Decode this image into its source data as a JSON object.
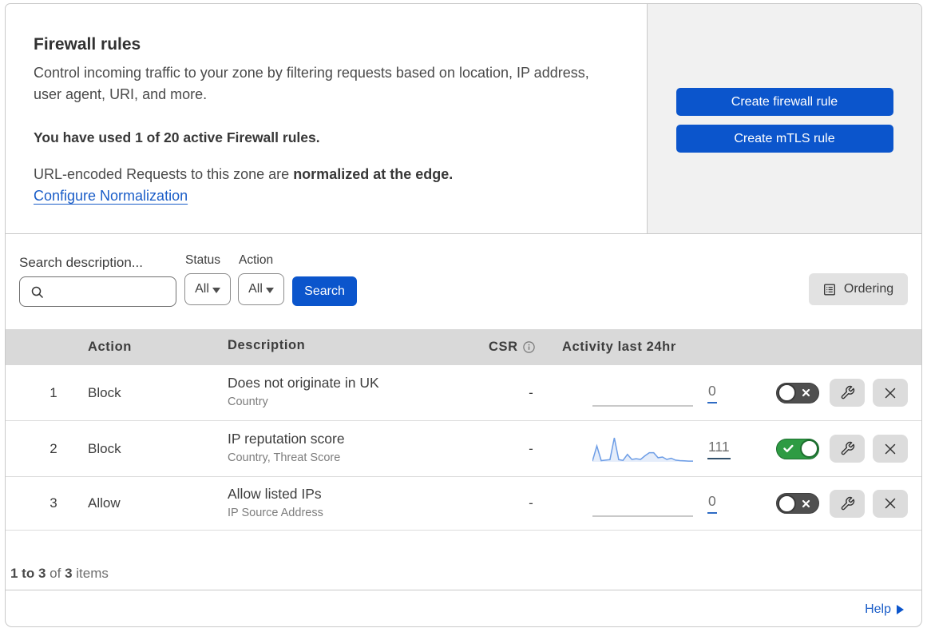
{
  "intro": {
    "title": "Firewall rules",
    "description": "Control incoming traffic to your zone by filtering requests based on location, IP address, user agent, URI, and more.",
    "usage": "You have used 1 of 20 active Firewall rules.",
    "normalization_prefix": "URL-encoded Requests to this zone are ",
    "normalization_bold": "normalized at the edge.",
    "normalization_link": "Configure Normalization"
  },
  "cta": {
    "create_firewall_rule": "Create firewall rule",
    "create_mtls_rule": "Create mTLS rule"
  },
  "filters": {
    "search_label": "Search description...",
    "search_placeholder": "",
    "search_value": "",
    "status_label": "Status",
    "status_value": "All",
    "action_label": "Action",
    "action_value": "All",
    "search_button": "Search",
    "ordering_button": "Ordering"
  },
  "table": {
    "headers": {
      "action": "Action",
      "description": "Description",
      "csr": "CSR",
      "activity": "Activity last 24hr"
    },
    "rows": [
      {
        "num": "1",
        "action": "Block",
        "description": "Does not originate in UK",
        "fields": "Country",
        "csr": "-",
        "activity_count": "0",
        "enabled": false,
        "underline_color": "#2e6bc4",
        "sparkline": [
          0,
          0,
          0,
          0,
          0,
          0,
          0,
          0,
          0,
          0,
          0,
          0,
          0,
          0,
          0,
          0,
          0,
          0,
          0,
          0,
          0,
          0,
          0,
          0
        ]
      },
      {
        "num": "2",
        "action": "Block",
        "description": "IP reputation score",
        "fields": "Country, Threat Score",
        "csr": "-",
        "activity_count": "111",
        "enabled": true,
        "underline_color": "#31506c",
        "sparkline": [
          3,
          66,
          5,
          7,
          9,
          100,
          9,
          6,
          31,
          10,
          13,
          10,
          25,
          38,
          38,
          17,
          20,
          10,
          15,
          7,
          5,
          4,
          3,
          3
        ]
      },
      {
        "num": "3",
        "action": "Allow",
        "description": "Allow listed IPs",
        "fields": "IP Source Address",
        "csr": "-",
        "activity_count": "0",
        "enabled": false,
        "underline_color": "#2e6bc4",
        "sparkline": [
          0,
          0,
          0,
          0,
          0,
          0,
          0,
          0,
          0,
          0,
          0,
          0,
          0,
          0,
          0,
          0,
          0,
          0,
          0,
          0,
          0,
          0,
          0,
          0
        ]
      }
    ],
    "footer": {
      "range": "1 to 3",
      "of": "of",
      "total": "3",
      "items": "items"
    }
  },
  "help_label": "Help",
  "colors": {
    "accent_blue": "#0b55cc",
    "link_blue": "#1a5dc8",
    "toggle_on_green": "#2e9b43",
    "sparkline_blue": "#6d9de6",
    "value_underline": "#35608d"
  }
}
